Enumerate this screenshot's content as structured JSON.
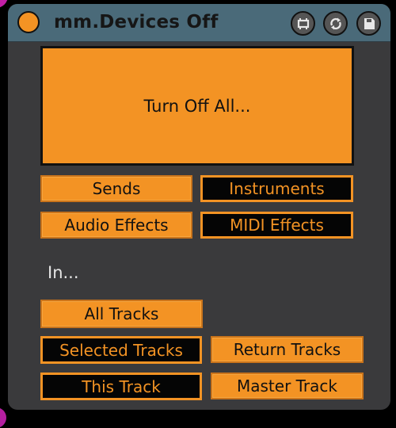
{
  "device": {
    "title": "mm.Devices Off",
    "power_icon": "power-toggle",
    "header_icons": [
      "chain-icon",
      "refresh-icon",
      "save-icon"
    ]
  },
  "main_action": {
    "label": "Turn Off All..."
  },
  "device_types": [
    {
      "label": "Sends",
      "state": "on"
    },
    {
      "label": "Instruments",
      "state": "off"
    },
    {
      "label": "Audio Effects",
      "state": "on"
    },
    {
      "label": "MIDI Effects",
      "state": "off"
    }
  ],
  "scope_label": "In...",
  "scopes": [
    {
      "label": "All Tracks",
      "state": "on"
    },
    {
      "label": "Selected Tracks",
      "state": "off"
    },
    {
      "label": "Return Tracks",
      "state": "on"
    },
    {
      "label": "This Track",
      "state": "off"
    },
    {
      "label": "Master Track",
      "state": "on"
    }
  ],
  "colors": {
    "accent": "#f39324",
    "titlebar": "#4a6a79",
    "panel": "#3a3a3c",
    "off_fill": "#050505"
  }
}
